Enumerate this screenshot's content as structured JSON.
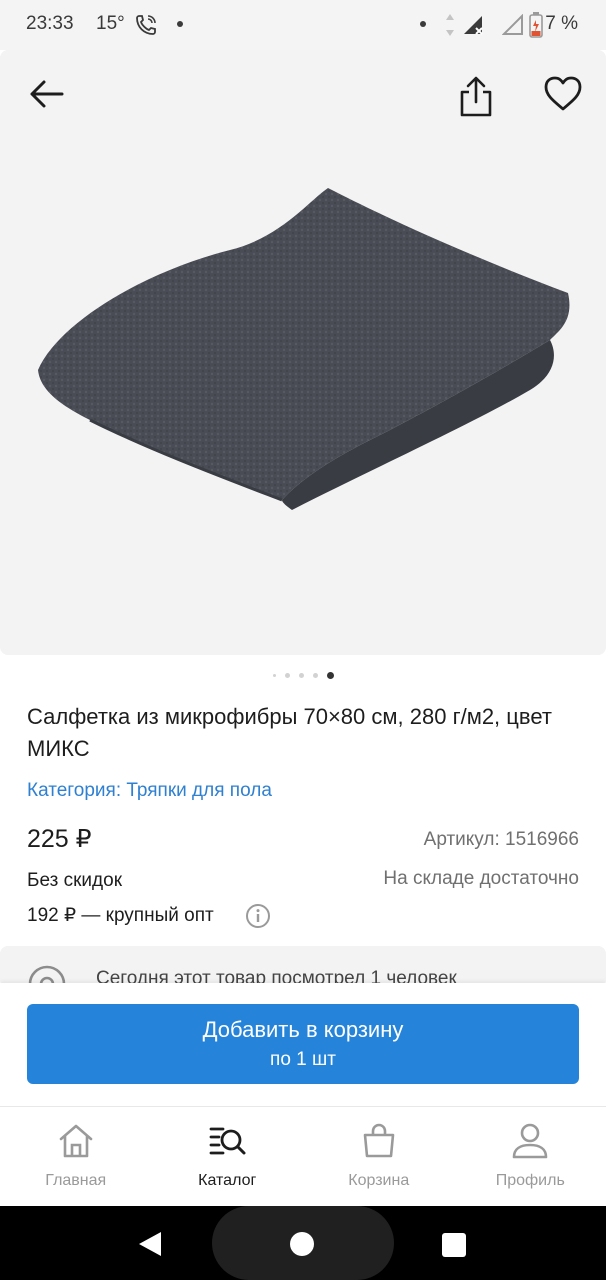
{
  "status_bar": {
    "time": "23:33",
    "temperature": "15°",
    "battery": "7 %"
  },
  "gallery": {
    "slide_count": 5,
    "active_slide_index": 4
  },
  "product": {
    "title": "Салфетка из микрофибры 70×80 см, 280 г/м2, цвет МИКС",
    "category": "Категория: Тряпки для пола",
    "price": "225 ₽",
    "article": "Артикул: 1516966",
    "discount": "Без скидок",
    "stock": "На складе достаточно",
    "wholesale": "192 ₽ — крупный опт"
  },
  "viewed_notice": "Сегодня этот товар посмотрел 1 человек",
  "cart_button": {
    "label": "Добавить в корзину",
    "sublabel": "по 1 шт"
  },
  "bottom_nav": [
    {
      "label": "Главная",
      "icon": "home-icon"
    },
    {
      "label": "Каталог",
      "icon": "catalog-search-icon",
      "active": true
    },
    {
      "label": "Корзина",
      "icon": "bag-icon"
    },
    {
      "label": "Профиль",
      "icon": "profile-icon"
    }
  ],
  "colors": {
    "accent": "#2584da",
    "link": "#2f80d0",
    "muted": "#707070"
  }
}
